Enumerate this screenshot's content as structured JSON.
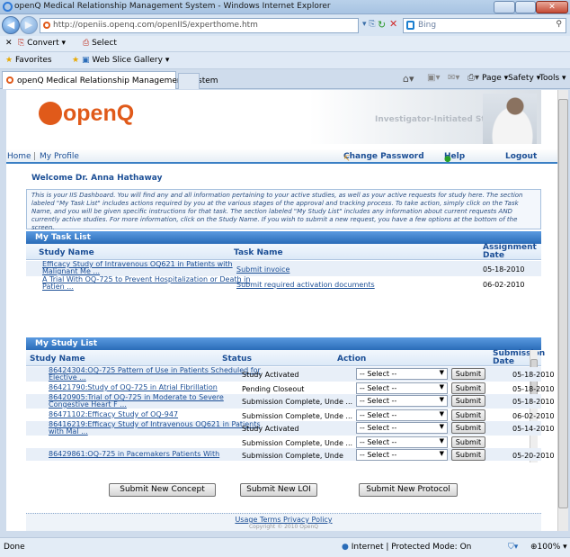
{
  "window": {
    "title": "openQ Medical Relationship Management System - Windows Internet Explorer"
  },
  "address": {
    "url": "http://openiis.openq.com/openIIS/experthome.htm",
    "search_placeholder": "Bing"
  },
  "commandbar": {
    "convert": "Convert",
    "select": "Select"
  },
  "favbar": {
    "favorites": "Favorites",
    "web_slice": "Web Slice Gallery"
  },
  "tab": {
    "title": "openQ Medical Relationship Management System"
  },
  "toolbar": {
    "page": "Page",
    "safety": "Safety",
    "tools": "Tools"
  },
  "banner": {
    "logo": "openQ",
    "product": "Investigator-Initiated Study"
  },
  "sitenav": {
    "home": "Home",
    "profile": "My Profile",
    "change_password": "Change Password",
    "help": "Help",
    "logout": "Logout"
  },
  "welcome": "Welcome Dr. Anna Hathaway",
  "intro": "This is your IIS Dashboard. You will find any and all information pertaining to your active studies, as well as your active requests for study here. The section labeled \"My Task List\" includes actions required by you at the various stages of the approval and tracking process. To take action, simply click on the Task Name, and you will be given specific instructions for that task. The section labeled \"My Study List\" includes any information about current requests AND currently active studies. For more information, click on the Study Name. If you wish to submit a new request, you have a few options at the bottom of the screen.",
  "tasklist": {
    "title": "My Task List",
    "headers": {
      "study": "Study Name",
      "task": "Task Name",
      "date_l1": "Assignment",
      "date_l2": "Date"
    },
    "rows": [
      {
        "study_l1": "Efficacy Study of Intravenous OQ621 in Patients with",
        "study_l2": "Malignant Me ...",
        "task": "Submit invoice",
        "date": "05-18-2010"
      },
      {
        "study_l1": "A Trial With OQ-725 to Prevent Hospitalization or Death in",
        "study_l2": "Patien ...",
        "task": "Submit required activation documents",
        "date": "06-02-2010"
      }
    ]
  },
  "studylist": {
    "title": "My Study List",
    "headers": {
      "study": "Study Name",
      "status": "Status",
      "action": "Action",
      "date_l1": "Submission",
      "date_l2": "Date"
    },
    "select_label": "-- Select --",
    "submit_label": "Submit",
    "rows": [
      {
        "study_l1": "86424304:OQ-725 Pattern of Use in Patients Scheduled for",
        "study_l2": "Elective ...",
        "status": "Study Activated",
        "date": "05-18-2010"
      },
      {
        "study_l1": "86421790:Study of OQ-725 in Atrial Fibrillation",
        "study_l2": "",
        "status": "Pending Closeout",
        "date": "05-18-2010"
      },
      {
        "study_l1": "86420905:Trial of OQ-725 in Moderate to Severe",
        "study_l2": "Congestive Heart F ...",
        "status": "Submission Complete, Unde ...",
        "date": "05-18-2010"
      },
      {
        "study_l1": "86471102:Efficacy Study of OQ-947",
        "study_l2": "",
        "status": "Submission Complete, Unde ...",
        "date": "06-02-2010"
      },
      {
        "study_l1": "86416219:Efficacy Study of Intravenous OQ621 in Patients",
        "study_l2": "with Mal ...",
        "status": "Study Activated",
        "date": "05-14-2010"
      },
      {
        "study_l1": "",
        "study_l2": "",
        "status": "Submission Complete, Unde ...",
        "date": ""
      },
      {
        "study_l1": "86429861:OQ-725 in Pacemakers Patients With",
        "study_l2": "",
        "status": "Submission Complete, Unde",
        "date": "05-20-2010"
      }
    ]
  },
  "actions": {
    "concept": "Submit New Concept",
    "loi": "Submit New LOI",
    "protocol": "Submit New Protocol"
  },
  "footer": {
    "links": "Usage Terms Privacy Policy",
    "copyright": "Copyright © 2010 OpenQ"
  },
  "status": {
    "left": "Done",
    "zone": "Internet | Protected Mode: On",
    "zoom": "100%"
  }
}
